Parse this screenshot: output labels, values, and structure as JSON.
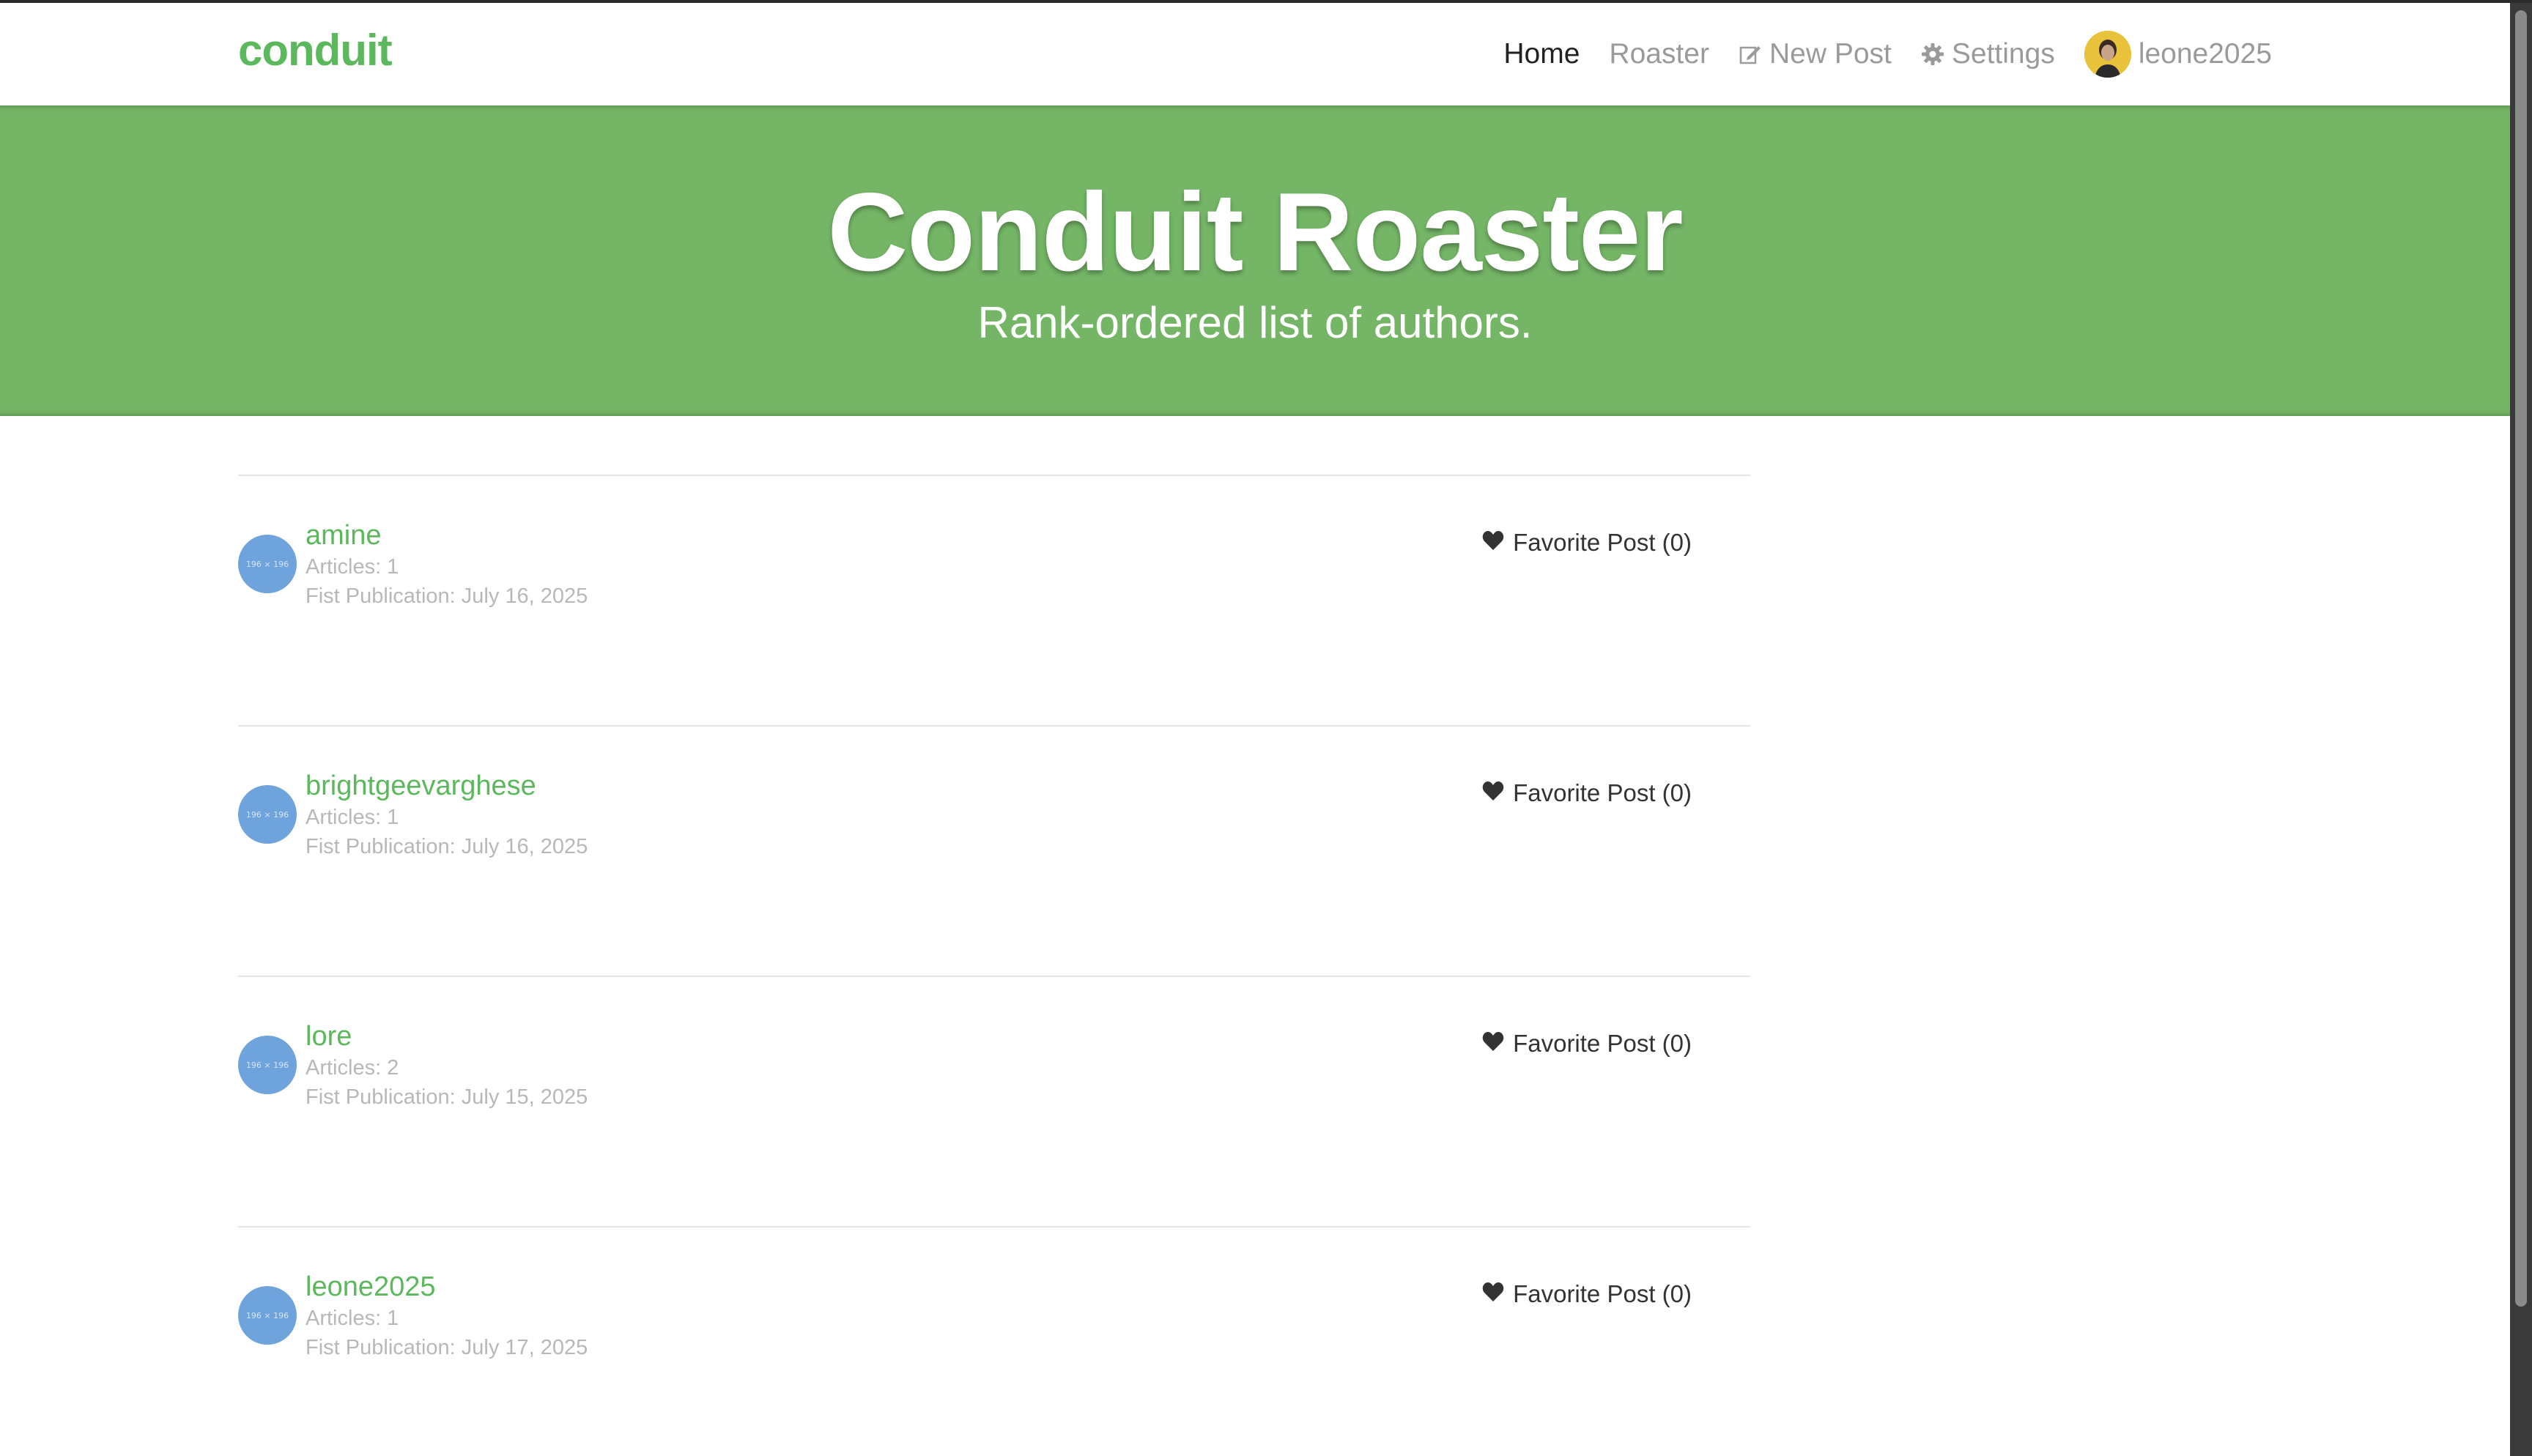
{
  "navbar": {
    "brand": "conduit",
    "links": {
      "home": "Home",
      "roaster": "Roaster",
      "new_post": "New Post",
      "settings": "Settings",
      "user": "leone2025"
    },
    "icons": {
      "new_post": "edit-icon",
      "settings": "gear-icon"
    }
  },
  "banner": {
    "title": "Conduit Roaster",
    "subtitle": "Rank-ordered list of authors."
  },
  "authors": [
    {
      "name": "amine",
      "articles": "Articles: 1",
      "first_publication": "Fist Publication: July 16, 2025",
      "favorite": "Favorite Post (0)",
      "avatar_text": "196 × 196"
    },
    {
      "name": "brightgeevarghese",
      "articles": "Articles: 1",
      "first_publication": "Fist Publication: July 16, 2025",
      "favorite": "Favorite Post (0)",
      "avatar_text": "196 × 196"
    },
    {
      "name": "lore",
      "articles": "Articles: 2",
      "first_publication": "Fist Publication: July 15, 2025",
      "favorite": "Favorite Post (0)",
      "avatar_text": "196 × 196"
    },
    {
      "name": "leone2025",
      "articles": "Articles: 1",
      "first_publication": "Fist Publication: July 17, 2025",
      "favorite": "Favorite Post (0)",
      "avatar_text": "196 × 196"
    }
  ],
  "colors": {
    "brand_green": "#5cb85c",
    "banner_green": "#74b566",
    "avatar_blue": "#6ea3dc",
    "muted_text": "#b8b8b8"
  }
}
